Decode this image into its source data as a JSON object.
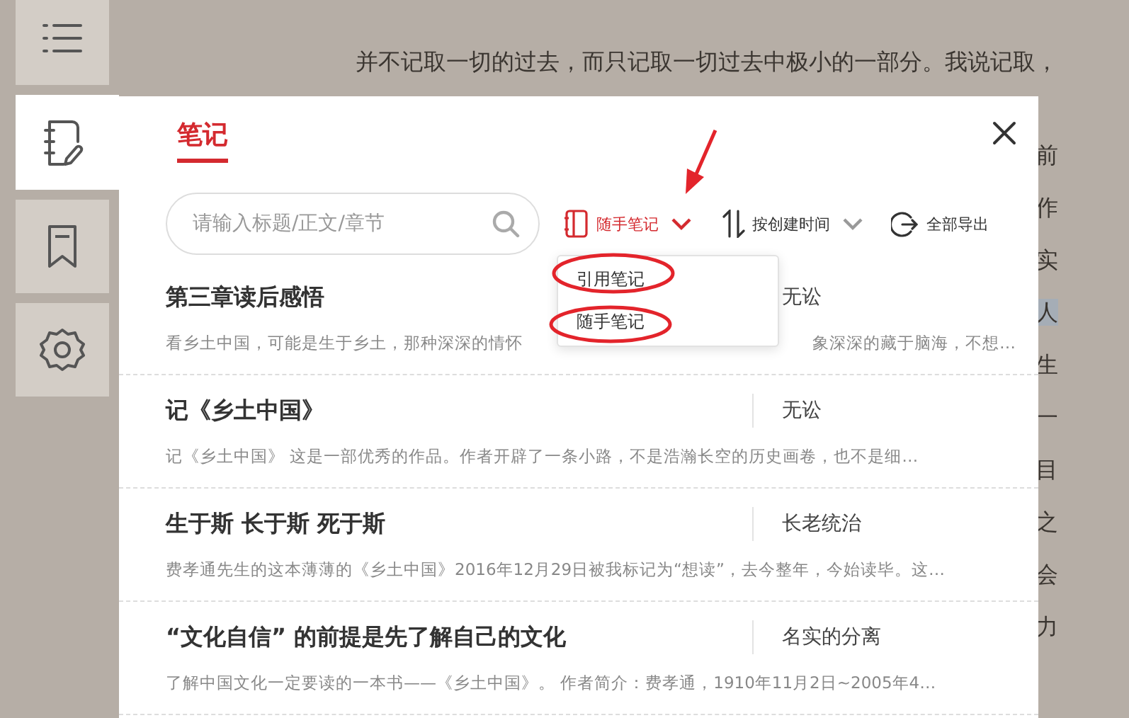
{
  "sidebar": {
    "items": [
      {
        "kind": "menu",
        "selected": false
      },
      {
        "kind": "notes",
        "selected": true
      },
      {
        "kind": "bookmark",
        "selected": false
      },
      {
        "kind": "settings",
        "selected": false
      }
    ]
  },
  "reader": {
    "lines": [
      {
        "text": "并不记取一切的过去，而只记取一切过去中极小的一部分。我说记取，",
        "highlighted": false
      },
      {
        "text": "前",
        "highlighted": false
      },
      {
        "text": "作",
        "highlighted": false
      },
      {
        "text": "实",
        "highlighted": false
      },
      {
        "text": "人",
        "highlighted": true
      },
      {
        "text": "生",
        "highlighted": false
      },
      {
        "text": "一",
        "highlighted": false
      },
      {
        "text": "目",
        "highlighted": false
      },
      {
        "text": "之",
        "highlighted": false
      },
      {
        "text": "会",
        "highlighted": false
      },
      {
        "text": "力",
        "highlighted": false
      }
    ]
  },
  "notes_panel": {
    "title": "笔记",
    "search": {
      "placeholder": "请输入标题/正文/章节"
    },
    "filter": {
      "label": "随手笔记",
      "expanded": true
    },
    "sort": {
      "label": "按创建时间"
    },
    "export": {
      "label": "全部导出"
    },
    "filter_menu": [
      {
        "label": "引用笔记"
      },
      {
        "label": "随手笔记"
      }
    ],
    "notes": [
      {
        "title": "第三章读后感悟",
        "chapter": "无讼",
        "excerpt": [
          "看乡土中国，可能是生于乡土，那种深深的情怀",
          "象深深的藏于脑海，不想…"
        ]
      },
      {
        "title": "记《乡土中国》",
        "chapter": "无讼",
        "excerpt": [
          "记《乡土中国》 这是一部优秀的作品。作者开辟了一条小路，不是浩瀚长空的历史画卷，也不是细…"
        ]
      },
      {
        "title": "生于斯 长于斯 死于斯",
        "chapter": "长老统治",
        "excerpt": [
          "费孝通先生的这本薄薄的《乡土中国》2016年12月29日被我标记为“想读”，去今整年，今始读毕。这…"
        ]
      },
      {
        "title": "“文化自信” 的前提是先了解自己的文化",
        "chapter": "名实的分离",
        "excerpt": [
          "了解中国文化一定要读的一本书——《乡土中国》。 作者简介：费孝通，1910年11月2日~2005年4…"
        ]
      }
    ]
  },
  "annotations": [
    {
      "kind": "arrow"
    },
    {
      "kind": "ellipse"
    },
    {
      "kind": "ellipse"
    }
  ]
}
